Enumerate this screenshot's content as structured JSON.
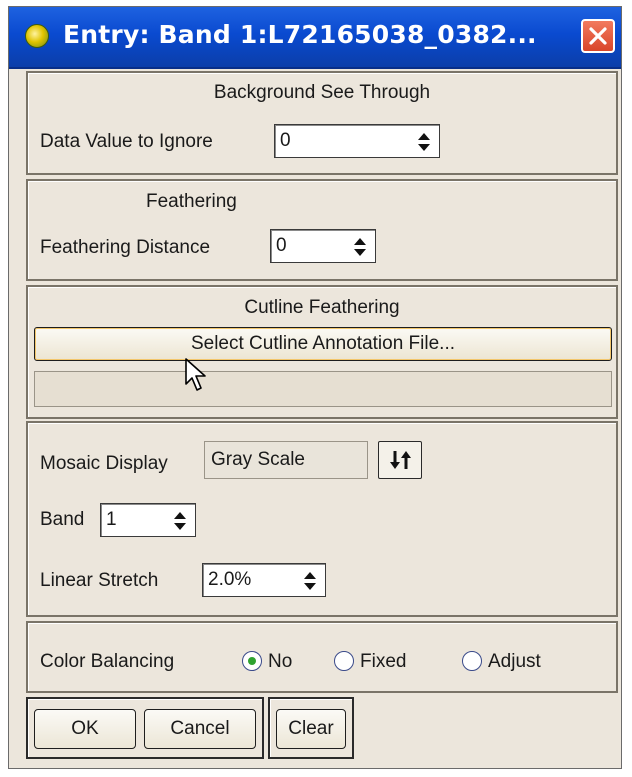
{
  "window": {
    "title": "Entry: Band 1:L72165038_0382..."
  },
  "background": {
    "title": "Background See Through",
    "label": "Data Value to Ignore",
    "value": "0"
  },
  "feathering": {
    "title": "Feathering",
    "label": "Feathering Distance",
    "value": "0"
  },
  "cutline": {
    "title": "Cutline Feathering",
    "button_label": "Select Cutline Annotation File...",
    "file_value": ""
  },
  "mosaic": {
    "display_label": "Mosaic Display",
    "display_value": "Gray Scale",
    "band_label": "Band",
    "band_value": "1",
    "stretch_label": "Linear Stretch",
    "stretch_value": "2.0%"
  },
  "color_balancing": {
    "label": "Color Balancing",
    "options": [
      "No",
      "Fixed",
      "Adjust"
    ],
    "selected": "No"
  },
  "buttons": {
    "ok": "OK",
    "cancel": "Cancel",
    "clear": "Clear"
  },
  "icons": {
    "app": "app-globe-icon",
    "close": "close-icon",
    "spin": "spin-arrows-icon",
    "sort": "sort-toggle-icon",
    "cursor": "mouse-cursor-icon"
  },
  "colors": {
    "titlebar": "#0a4ad0",
    "panel": "#ece6dc",
    "close": "#d9452a",
    "radio_selected": "#2fa22f"
  }
}
